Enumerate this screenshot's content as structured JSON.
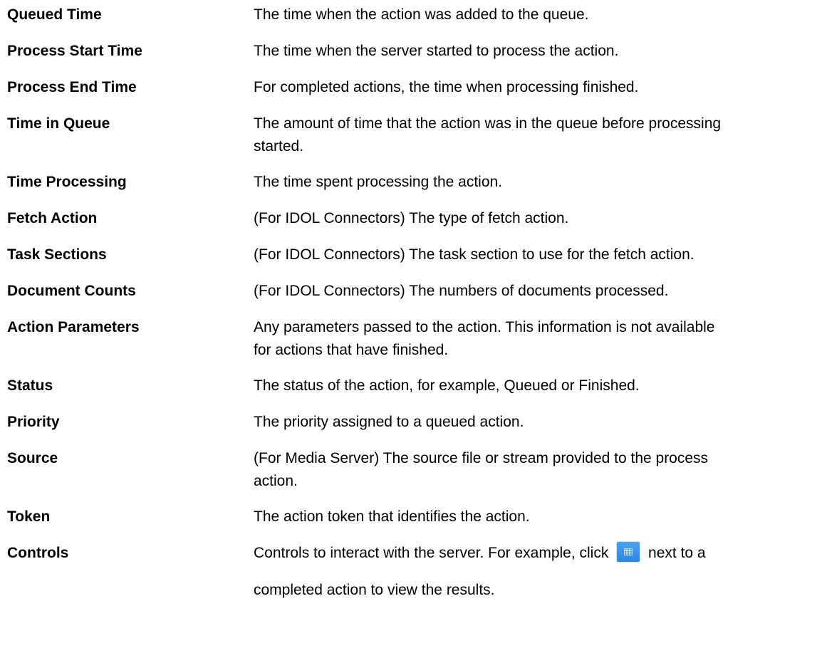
{
  "rows": [
    {
      "term": "Queued Time",
      "lines": [
        "The time when the action was added to the queue."
      ]
    },
    {
      "term": "Process Start Time",
      "lines": [
        "The time when the server started to process the action."
      ]
    },
    {
      "term": "Process End Time",
      "lines": [
        "For completed actions, the time when processing finished."
      ]
    },
    {
      "term": "Time in Queue",
      "lines": [
        "The amount of time that the action was in the queue before processing",
        "started."
      ]
    },
    {
      "term": "Time Processing",
      "lines": [
        "The time spent processing the action."
      ]
    },
    {
      "term": "Fetch Action",
      "lines": [
        "(For IDOL Connectors) The type of fetch action."
      ]
    },
    {
      "term": "Task Sections",
      "lines": [
        "(For IDOL Connectors) The task section to use for the fetch action."
      ]
    },
    {
      "term": "Document Counts",
      "lines": [
        "(For IDOL Connectors) The numbers of documents processed."
      ]
    },
    {
      "term": "Action Parameters",
      "lines": [
        "Any parameters passed to the action. This information is not available",
        "for actions that have finished."
      ]
    },
    {
      "term": "Status",
      "lines": [
        "The status of the action, for example, Queued or Finished."
      ]
    },
    {
      "term": "Priority",
      "lines": [
        "The priority assigned to a queued action."
      ]
    },
    {
      "term": "Source",
      "lines": [
        "(For Media Server) The source file or stream provided to the process",
        "action."
      ]
    },
    {
      "term": "Token",
      "lines": [
        "The action token that identifies the action."
      ]
    }
  ],
  "controls": {
    "term": "Controls",
    "line1_before": "Controls to interact with the server. For example, click",
    "line1_after": "next to a",
    "line2": "completed action to view the results.",
    "button_icon": "grid-icon",
    "button_color": "#2b86e6"
  }
}
